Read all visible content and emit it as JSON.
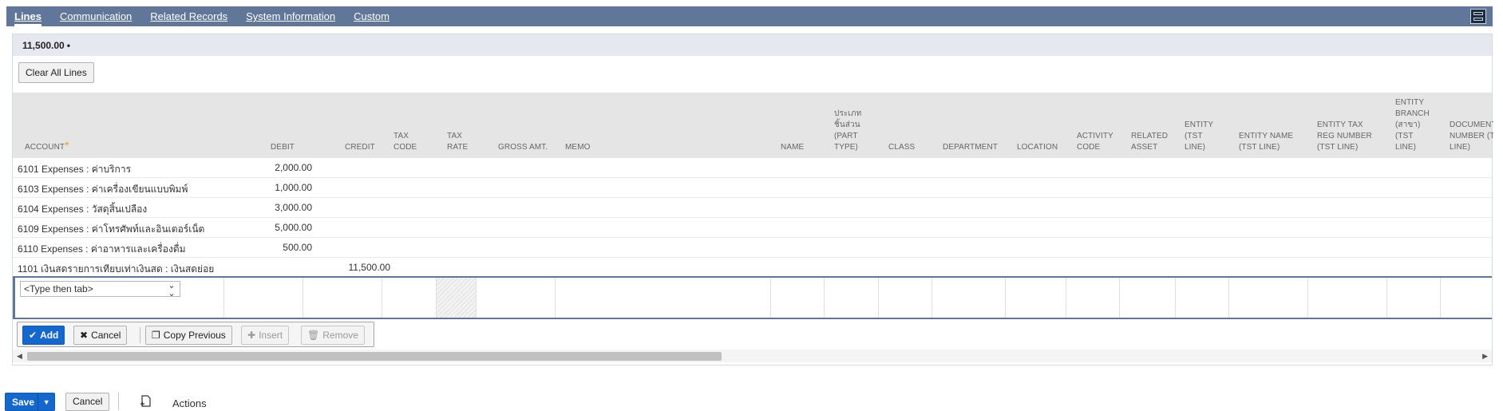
{
  "tabs": [
    "Lines",
    "Communication",
    "Related Records",
    "System Information",
    "Custom"
  ],
  "active_tab": "Lines",
  "total": "11,500.00",
  "total_marker": "•",
  "clear_all_label": "Clear All Lines",
  "columns": {
    "account": "ACCOUNT",
    "debit": "DEBIT",
    "credit": "CREDIT",
    "tax_code": "TAX CODE",
    "tax_rate": "TAX RATE",
    "gross_amt": "GROSS AMT.",
    "memo": "MEMO",
    "name": "NAME",
    "part_type": "ประเภท ชิ้นส่วน (PART TYPE)",
    "class": "CLASS",
    "department": "DEPARTMENT",
    "location": "LOCATION",
    "activity_code": "ACTIVITY CODE",
    "related_asset": "RELATED ASSET",
    "entity_tst": "ENTITY (TST LINE)",
    "entity_name": "ENTITY NAME (TST LINE)",
    "entity_tax_reg": "ENTITY TAX REG NUMBER (TST LINE)",
    "entity_branch": "ENTITY BRANCH (สาขา) (TST LINE)",
    "document_number": "DOCUMENT NUMBER (TST LINE)"
  },
  "rows": [
    {
      "account": "6101 Expenses : ค่าบริการ",
      "debit": "2,000.00",
      "credit": ""
    },
    {
      "account": "6103 Expenses : ค่าเครื่องเขียนแบบพิมพ์",
      "debit": "1,000.00",
      "credit": ""
    },
    {
      "account": "6104 Expenses : วัสดุสิ้นเปลือง",
      "debit": "3,000.00",
      "credit": ""
    },
    {
      "account": "6109 Expenses : ค่าโทรศัพท์และอินเตอร์เน็ต",
      "debit": "5,000.00",
      "credit": ""
    },
    {
      "account": "6110 Expenses : ค่าอาหารและเครื่องดื่ม",
      "debit": "500.00",
      "credit": ""
    },
    {
      "account": "1101 เงินสดรายการเทียบเท่าเงินสด : เงินสดย่อย",
      "debit": "",
      "credit": "11,500.00"
    }
  ],
  "account_input_placeholder": "<Type then tab>",
  "line_buttons": {
    "add": "Add",
    "cancel": "Cancel",
    "copy_previous": "Copy Previous",
    "insert": "Insert",
    "remove": "Remove"
  },
  "footer": {
    "save": "Save",
    "cancel": "Cancel",
    "actions": "Actions"
  },
  "colors": {
    "tab_bar": "#607799",
    "primary_button": "#1467cc",
    "required_star": "#f29f2b"
  }
}
